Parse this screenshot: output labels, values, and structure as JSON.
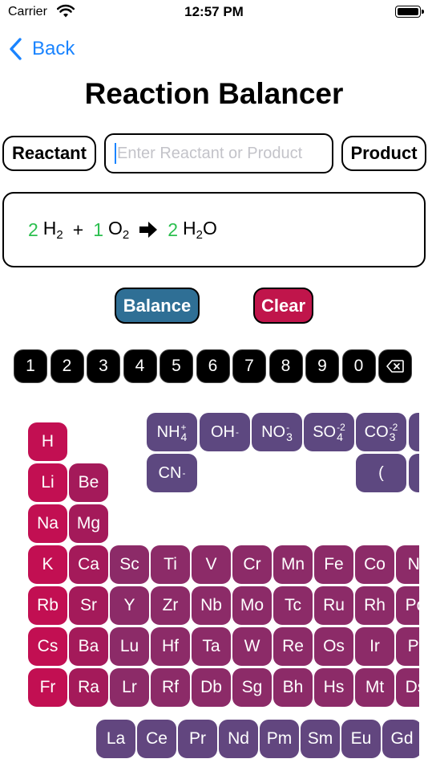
{
  "status_bar": {
    "carrier": "Carrier",
    "time": "12:57 PM"
  },
  "nav": {
    "back_label": "Back",
    "title": "Reaction Balancer"
  },
  "entry": {
    "reactant_label": "Reactant",
    "product_label": "Product",
    "placeholder": "Enter Reactant or Product",
    "value": ""
  },
  "equation": {
    "terms": [
      {
        "coef": "2",
        "el1": "H",
        "sub1": "2"
      },
      {
        "plus": "+"
      },
      {
        "coef": "1",
        "el1": "O",
        "sub1": "2"
      }
    ],
    "products": [
      {
        "coef": "2",
        "el1": "H",
        "sub1": "2",
        "el2": "O"
      }
    ]
  },
  "actions": {
    "balance_label": "Balance",
    "clear_label": "Clear"
  },
  "digits": [
    "1",
    "2",
    "3",
    "4",
    "5",
    "6",
    "7",
    "8",
    "9",
    "0"
  ],
  "ions": {
    "nh4": {
      "base": "NH",
      "sub": "4",
      "sup": "+"
    },
    "oh": {
      "base": "OH",
      "sup": "-"
    },
    "no3": {
      "base": "NO",
      "sub": "3",
      "sup": "-"
    },
    "so4": {
      "base": "SO",
      "sub": "4",
      "sup": "-2"
    },
    "co3": {
      "base": "CO",
      "sub": "3",
      "sup": "-2"
    },
    "cn": {
      "base": "CN",
      "sup": "-"
    },
    "paren": "("
  },
  "colors": {
    "alkali": "#c20f52",
    "alkaline": "#a41a5a",
    "transition": "#8c2b68",
    "lanthanide": "#62467f",
    "ion": "#5d4880",
    "accent": "#1a84ff",
    "coef": "#2bbf4f",
    "balance": "#2f6f95",
    "clear": "#c0154b"
  },
  "elements": {
    "row1": [
      "H"
    ],
    "row2": [
      "Li",
      "Be"
    ],
    "row3": [
      "Na",
      "Mg"
    ],
    "row4": [
      "K",
      "Ca",
      "Sc",
      "Ti",
      "V",
      "Cr",
      "Mn",
      "Fe",
      "Co",
      "Ni"
    ],
    "row5": [
      "Rb",
      "Sr",
      "Y",
      "Zr",
      "Nb",
      "Mo",
      "Tc",
      "Ru",
      "Rh",
      "Pd"
    ],
    "row6": [
      "Cs",
      "Ba",
      "Lu",
      "Hf",
      "Ta",
      "W",
      "Re",
      "Os",
      "Ir",
      "Pt"
    ],
    "row7": [
      "Fr",
      "Ra",
      "Lr",
      "Rf",
      "Db",
      "Sg",
      "Bh",
      "Hs",
      "Mt",
      "Ds"
    ],
    "lanthanides": [
      "La",
      "Ce",
      "Pr",
      "Nd",
      "Pm",
      "Sm",
      "Eu",
      "Gd"
    ]
  }
}
